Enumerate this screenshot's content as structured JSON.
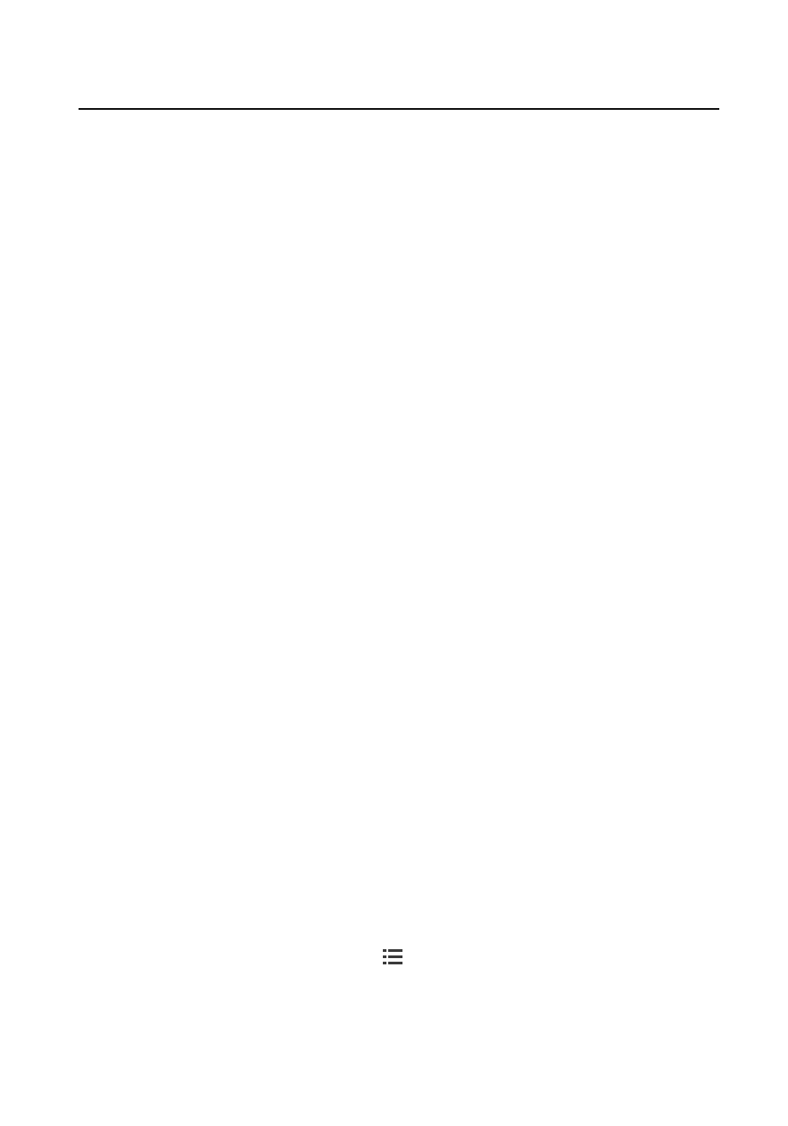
{
  "page": {
    "background_color": "#ffffff",
    "rule_color": "#111111"
  },
  "icons": {
    "list": {
      "name": "list-icon",
      "color": "#3a3a3a"
    }
  }
}
